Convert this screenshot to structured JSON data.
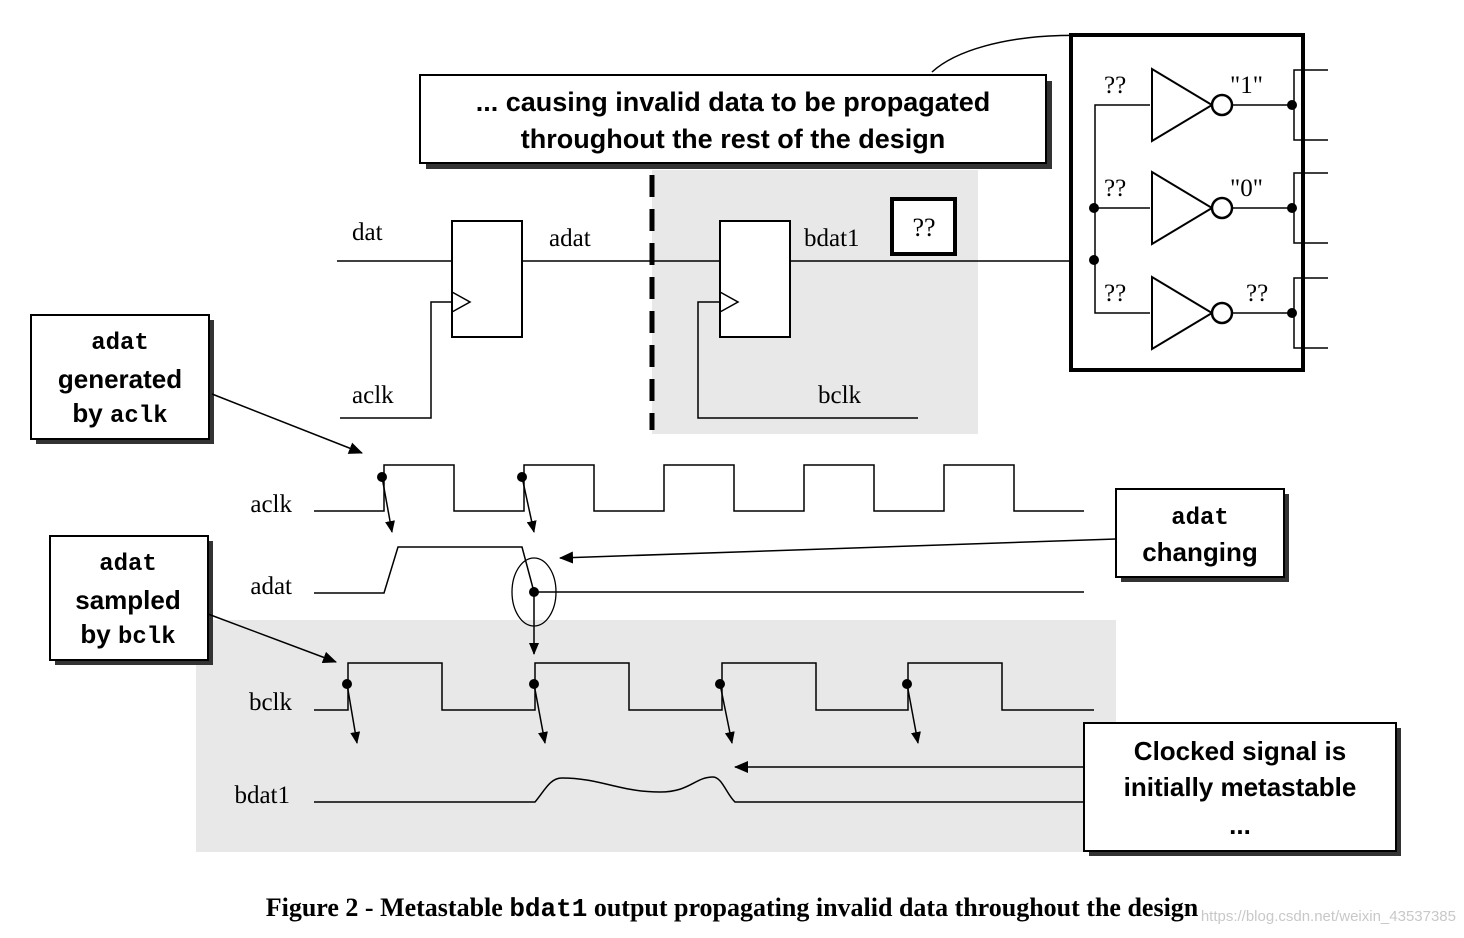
{
  "figure": {
    "caption_prefix": "Figure 2 - Metastable ",
    "caption_code": "bdat1",
    "caption_suffix": " output propagating invalid data throughout the design",
    "watermark": "https://blog.csdn.net/weixin_43537385"
  },
  "callouts": {
    "top": {
      "line1": "... causing invalid data to be propagated",
      "line2": "throughout the rest of the design"
    },
    "adat_generated": {
      "line1_code": "adat",
      "line2": "generated",
      "line3_prefix": "by ",
      "line3_code": "aclk"
    },
    "adat_sampled": {
      "line1_code": "adat",
      "line2": "sampled",
      "line3_prefix": "by ",
      "line3_code": "bclk"
    },
    "adat_changing": {
      "line1_code": "adat",
      "line2": "changing"
    },
    "metastable": {
      "line1": "Clocked signal is",
      "line2": "initially metastable",
      "line3": "..."
    }
  },
  "circuit": {
    "signals": {
      "dat": "dat",
      "adat": "adat",
      "aclk": "aclk",
      "bdat1": "bdat1",
      "bclk": "bclk"
    },
    "bdat1_value": "??",
    "inverters": [
      {
        "input": "??",
        "output": "\"1\""
      },
      {
        "input": "??",
        "output": "\"0\""
      },
      {
        "input": "??",
        "output": "??"
      }
    ]
  },
  "waveforms": {
    "labels": [
      "aclk",
      "adat",
      "bclk",
      "bdat1"
    ]
  },
  "colors": {
    "shade": "#e8e8e8",
    "ink": "#000000"
  }
}
